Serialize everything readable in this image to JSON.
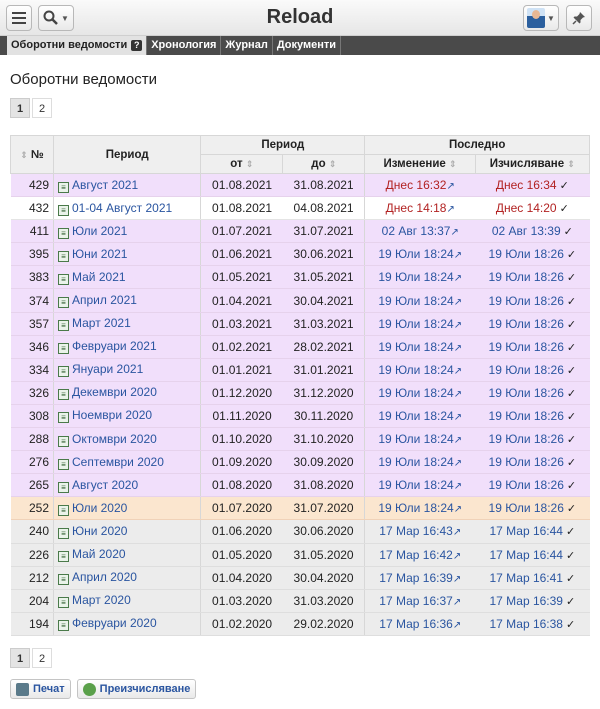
{
  "header": {
    "title": "Reload",
    "menu_icon": "hamburger-menu-icon",
    "search_icon": "magnifier-icon",
    "user_icon": "user-avatar-icon",
    "pin_icon": "pin-icon"
  },
  "tabs": [
    {
      "label": "Оборотни ведомости",
      "active": true
    },
    {
      "label": "Хронология",
      "active": false
    },
    {
      "label": "Журнал",
      "active": false
    },
    {
      "label": "Документи",
      "active": false
    }
  ],
  "tab_help_icon": "?",
  "page": {
    "title": "Оборотни ведомости"
  },
  "pagination": {
    "pages": [
      "1",
      "2"
    ],
    "current": "1"
  },
  "table": {
    "headers": {
      "num": "№",
      "period": "Период",
      "period_group": "Период",
      "from": "от",
      "to": "до",
      "last_group": "Последно",
      "modified": "Изменение",
      "calculated": "Изчисляване"
    },
    "rows": [
      {
        "num": "429",
        "period": "Август 2021",
        "from": "01.08.2021",
        "to": "31.08.2021",
        "modified": "Днес 16:32",
        "calculated": "Днес 16:34",
        "style": "purple",
        "highlight": true
      },
      {
        "num": "432",
        "period": "01-04 Август 2021",
        "from": "01.08.2021",
        "to": "04.08.2021",
        "modified": "Днес 14:18",
        "calculated": "Днес 14:20",
        "style": "white",
        "highlight": true
      },
      {
        "num": "411",
        "period": "Юли 2021",
        "from": "01.07.2021",
        "to": "31.07.2021",
        "modified": "02 Авг 13:37",
        "calculated": "02 Авг 13:39",
        "style": "purple",
        "highlight": false
      },
      {
        "num": "395",
        "period": "Юни 2021",
        "from": "01.06.2021",
        "to": "30.06.2021",
        "modified": "19 Юли 18:24",
        "calculated": "19 Юли 18:26",
        "style": "purple",
        "highlight": false
      },
      {
        "num": "383",
        "period": "Май 2021",
        "from": "01.05.2021",
        "to": "31.05.2021",
        "modified": "19 Юли 18:24",
        "calculated": "19 Юли 18:26",
        "style": "purple",
        "highlight": false
      },
      {
        "num": "374",
        "period": "Април 2021",
        "from": "01.04.2021",
        "to": "30.04.2021",
        "modified": "19 Юли 18:24",
        "calculated": "19 Юли 18:26",
        "style": "purple",
        "highlight": false
      },
      {
        "num": "357",
        "period": "Март 2021",
        "from": "01.03.2021",
        "to": "31.03.2021",
        "modified": "19 Юли 18:24",
        "calculated": "19 Юли 18:26",
        "style": "purple",
        "highlight": false
      },
      {
        "num": "346",
        "period": "Февруари 2021",
        "from": "01.02.2021",
        "to": "28.02.2021",
        "modified": "19 Юли 18:24",
        "calculated": "19 Юли 18:26",
        "style": "purple",
        "highlight": false
      },
      {
        "num": "334",
        "period": "Януари 2021",
        "from": "01.01.2021",
        "to": "31.01.2021",
        "modified": "19 Юли 18:24",
        "calculated": "19 Юли 18:26",
        "style": "purple",
        "highlight": false
      },
      {
        "num": "326",
        "period": "Декември 2020",
        "from": "01.12.2020",
        "to": "31.12.2020",
        "modified": "19 Юли 18:24",
        "calculated": "19 Юли 18:26",
        "style": "purple",
        "highlight": false
      },
      {
        "num": "308",
        "period": "Ноември 2020",
        "from": "01.11.2020",
        "to": "30.11.2020",
        "modified": "19 Юли 18:24",
        "calculated": "19 Юли 18:26",
        "style": "purple",
        "highlight": false
      },
      {
        "num": "288",
        "period": "Октомври 2020",
        "from": "01.10.2020",
        "to": "31.10.2020",
        "modified": "19 Юли 18:24",
        "calculated": "19 Юли 18:26",
        "style": "purple",
        "highlight": false
      },
      {
        "num": "276",
        "period": "Септември 2020",
        "from": "01.09.2020",
        "to": "30.09.2020",
        "modified": "19 Юли 18:24",
        "calculated": "19 Юли 18:26",
        "style": "purple",
        "highlight": false
      },
      {
        "num": "265",
        "period": "Август 2020",
        "from": "01.08.2020",
        "to": "31.08.2020",
        "modified": "19 Юли 18:24",
        "calculated": "19 Юли 18:26",
        "style": "purple",
        "highlight": false
      },
      {
        "num": "252",
        "period": "Юли 2020",
        "from": "01.07.2020",
        "to": "31.07.2020",
        "modified": "19 Юли 18:24",
        "calculated": "19 Юли 18:26",
        "style": "orange",
        "highlight": false
      },
      {
        "num": "240",
        "period": "Юни 2020",
        "from": "01.06.2020",
        "to": "30.06.2020",
        "modified": "17 Мар 16:43",
        "calculated": "17 Мар 16:44",
        "style": "gray",
        "highlight": false
      },
      {
        "num": "226",
        "period": "Май 2020",
        "from": "01.05.2020",
        "to": "31.05.2020",
        "modified": "17 Мар 16:42",
        "calculated": "17 Мар 16:44",
        "style": "gray",
        "highlight": false
      },
      {
        "num": "212",
        "period": "Април 2020",
        "from": "01.04.2020",
        "to": "30.04.2020",
        "modified": "17 Мар 16:39",
        "calculated": "17 Мар 16:41",
        "style": "gray",
        "highlight": false
      },
      {
        "num": "204",
        "period": "Март 2020",
        "from": "01.03.2020",
        "to": "31.03.2020",
        "modified": "17 Мар 16:37",
        "calculated": "17 Мар 16:39",
        "style": "gray",
        "highlight": false
      },
      {
        "num": "194",
        "period": "Февруари 2020",
        "from": "01.02.2020",
        "to": "29.02.2020",
        "modified": "17 Мар 16:36",
        "calculated": "17 Мар 16:38",
        "style": "gray",
        "highlight": false
      }
    ]
  },
  "actions": {
    "print": "Печат",
    "recalc": "Преизчисляване"
  },
  "colors": {
    "link": "#2a55a0",
    "today": "#b22222",
    "tabbar": "#4a4a4a",
    "row_purple": "#f1dffb",
    "row_orange": "#fbe6cf",
    "row_gray": "#ececec"
  }
}
